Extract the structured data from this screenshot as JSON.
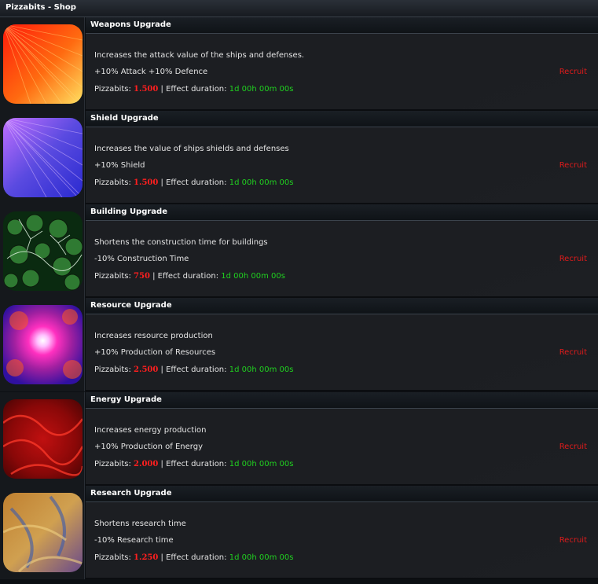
{
  "shop": {
    "title": "Pizzabits - Shop"
  },
  "labels": {
    "currency": "Pizzabits:",
    "separator": "|",
    "duration": "Effect duration:",
    "recruit": "Recruit"
  },
  "items": [
    {
      "title": "Weapons Upgrade",
      "description": "Increases the attack value of the ships and defenses.",
      "effect": "+10% Attack +10% Defence",
      "price": "1.500",
      "duration": "1d 00h 00m 00s",
      "icon": "weapons-upgrade-image"
    },
    {
      "title": "Shield Upgrade",
      "description": "Increases the value of ships shields and defenses",
      "effect": "+10% Shield",
      "price": "1.500",
      "duration": "1d 00h 00m 00s",
      "icon": "shield-upgrade-image"
    },
    {
      "title": "Building Upgrade",
      "description": "Shortens the construction time for buildings",
      "effect": "-10% Construction Time",
      "price": "750",
      "duration": "1d 00h 00m 00s",
      "icon": "building-upgrade-image"
    },
    {
      "title": "Resource Upgrade",
      "description": "Increases resource production",
      "effect": "+10% Production of Resources",
      "price": "2.500",
      "duration": "1d 00h 00m 00s",
      "icon": "resource-upgrade-image"
    },
    {
      "title": "Energy Upgrade",
      "description": "Increases energy production",
      "effect": "+10% Production of Energy",
      "price": "2.000",
      "duration": "1d 00h 00m 00s",
      "icon": "energy-upgrade-image"
    },
    {
      "title": "Research Upgrade",
      "description": "Shortens research time",
      "effect": "-10% Research time",
      "price": "1.250",
      "duration": "1d 00h 00m 00s",
      "icon": "research-upgrade-image"
    }
  ]
}
